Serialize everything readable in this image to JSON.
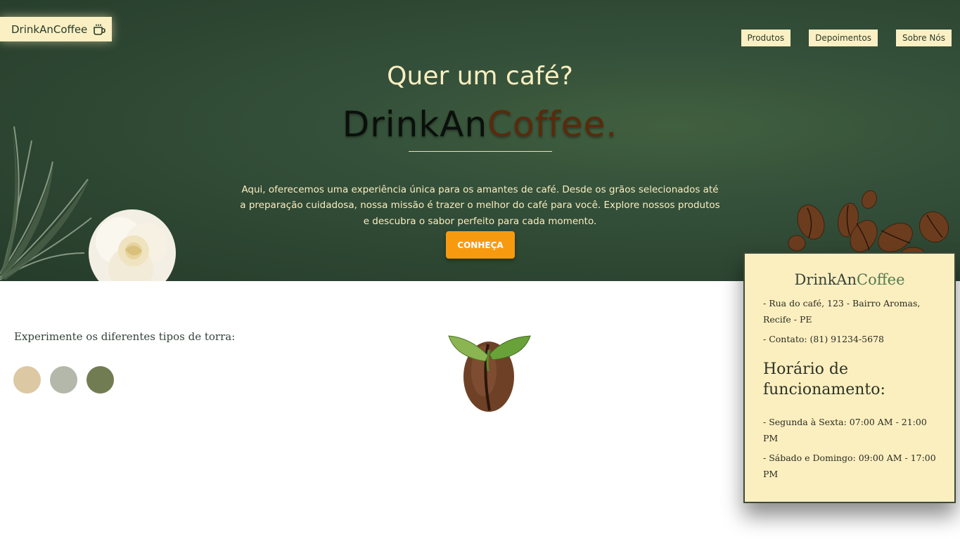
{
  "header": {
    "logo_text": "DrinkAnCoffee",
    "logo_icon": "coffee-cup-icon",
    "nav": [
      {
        "label": "Produtos"
      },
      {
        "label": "Depoimentos"
      },
      {
        "label": "Sobre Nós"
      }
    ]
  },
  "hero": {
    "question": "Quer um café?",
    "brand_part1": "Drink",
    "brand_part2": "An",
    "brand_part3": "Coffee.",
    "description": "Aqui, oferecemos uma experiência única para os amantes de café. Desde os grãos selecionados até a preparação cuidadosa, nossa missão é trazer o melhor do café para você. Explore nossos produtos e descubra o sabor perfeito para cada momento.",
    "cta_label": "CONHEÇA"
  },
  "roast": {
    "title": "Experimente os diferentes tipos de torra:",
    "swatches": [
      "#dcc9a4",
      "#b4b8ab",
      "#717c53"
    ]
  },
  "info": {
    "title_part1": "DrinkAn",
    "title_part2": "Coffee",
    "address": "- Rua do café, 123 - Bairro Aromas, Recife - PE",
    "contact": "- Contato: (81) 91234-5678",
    "hours_title": "Horário de funcionamento:",
    "weekdays": "- Segunda à Sexta: 07:00 AM - 21:00 PM",
    "weekend": "- Sábado e Domingo: 09:00 AM - 17:00 PM"
  },
  "colors": {
    "hero_bg": "#34503a",
    "cream": "#fbf0c3",
    "cta": "#f89a10"
  }
}
